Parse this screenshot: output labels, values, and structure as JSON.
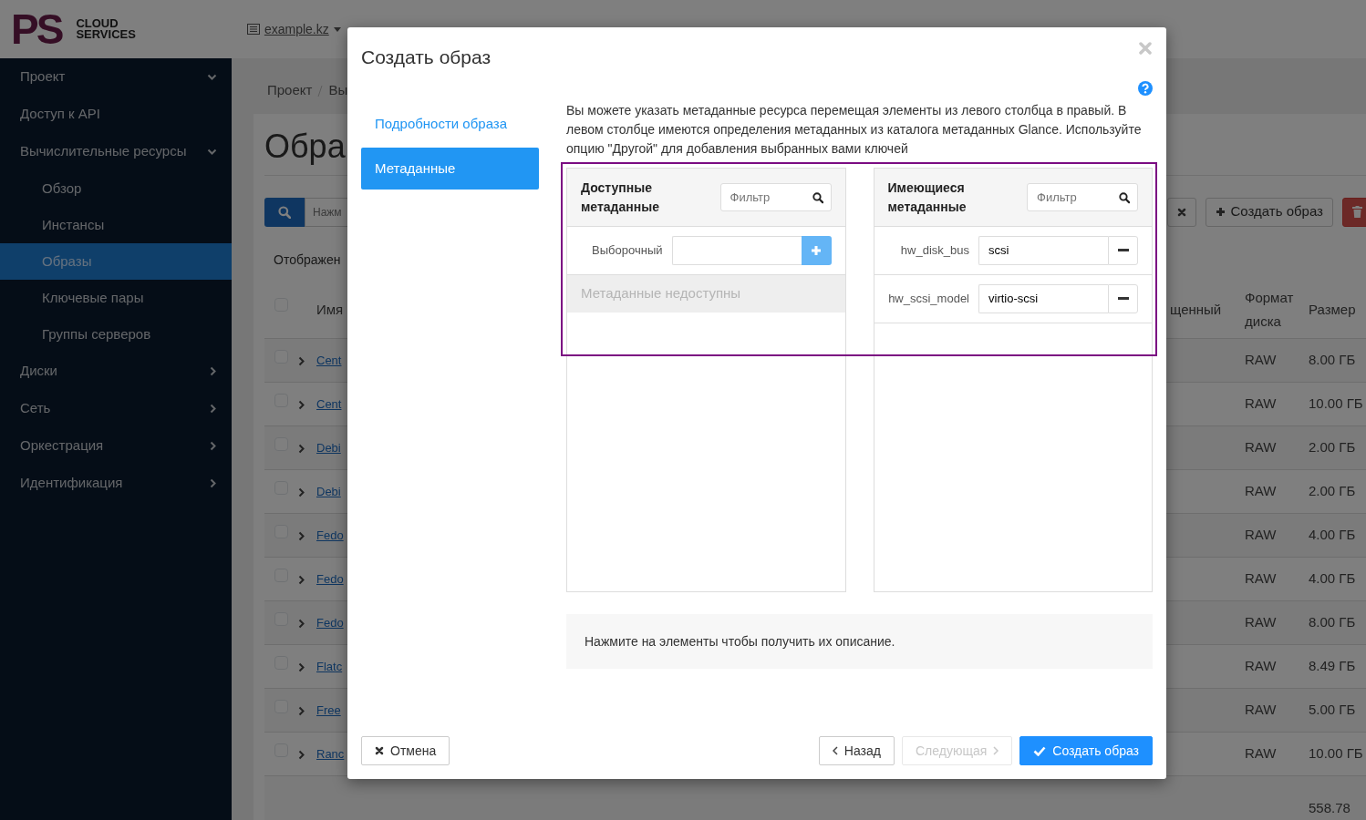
{
  "header": {
    "logo": {
      "mark": "PS",
      "lines": [
        "CLOUD",
        "SERVICES"
      ]
    },
    "project_selector": "example.kz"
  },
  "sidebar": {
    "items": [
      {
        "label": "Проект",
        "expanded": true,
        "selected": false,
        "children": [
          {
            "label": "Доступ к API",
            "selected": false
          },
          {
            "label": "Вычислительные ресурсы",
            "expanded": true,
            "selected": false,
            "children": [
              {
                "label": "Обзор",
                "selected": false
              },
              {
                "label": "Инстансы",
                "selected": false
              },
              {
                "label": "Образы",
                "selected": true
              },
              {
                "label": "Ключевые пары",
                "selected": false
              },
              {
                "label": "Группы серверов",
                "selected": false
              }
            ]
          },
          {
            "label": "Диски",
            "expanded": false,
            "selected": false
          },
          {
            "label": "Сеть",
            "expanded": false,
            "selected": false
          },
          {
            "label": "Оркестрация",
            "expanded": false,
            "selected": false
          }
        ]
      },
      {
        "label": "Идентификация",
        "expanded": false,
        "selected": false
      }
    ]
  },
  "page": {
    "breadcrumb": [
      "Проект",
      "Вы"
    ],
    "title": "Обра",
    "search": {
      "placeholder": "Нажм"
    },
    "actions": [
      {
        "kind": "clear"
      },
      {
        "kind": "create",
        "label": "Создать образ"
      },
      {
        "kind": "delete"
      }
    ],
    "summary": "Отображен",
    "table": {
      "select_all_checked": false,
      "columns": [
        "Имя",
        "щенный",
        "Формат диска",
        "Размер"
      ],
      "rows": [
        {
          "checked": false,
          "name": "Cent",
          "format": "RAW",
          "size": "8.00 ГБ"
        },
        {
          "checked": false,
          "name": "Cent",
          "format": "RAW",
          "size": "10.00 ГБ"
        },
        {
          "checked": false,
          "name": "Debi",
          "format": "RAW",
          "size": "2.00 ГБ"
        },
        {
          "checked": false,
          "name": "Debi",
          "format": "RAW",
          "size": "2.00 ГБ"
        },
        {
          "checked": false,
          "name": "Fedo",
          "format": "RAW",
          "size": "4.00 ГБ"
        },
        {
          "checked": false,
          "name": "Fedo",
          "format": "RAW",
          "size": "4.00 ГБ"
        },
        {
          "checked": false,
          "name": "Fedo",
          "format": "RAW",
          "size": "8.00 ГБ"
        },
        {
          "checked": false,
          "name": "Flatc",
          "format": "RAW",
          "size": "8.49 ГБ"
        },
        {
          "checked": false,
          "name": "Free",
          "format": "RAW",
          "size": "5.00 ГБ"
        },
        {
          "checked": false,
          "name": "Ranc",
          "format": "RAW",
          "size": "10.00 ГБ"
        }
      ],
      "total_size": "558.78"
    }
  },
  "modal": {
    "title": "Создать образ",
    "steps": [
      {
        "label": "Подробности образа",
        "selected": false
      },
      {
        "label": "Метаданные",
        "selected": true
      }
    ],
    "description": "Вы можете указать метаданные ресурса перемещая элементы из левого столбца в правый. В левом столбце имеются определения метаданных из каталога метаданных Glance. Используйте опцию \"Другой\" для добавления выбранных вами ключей",
    "available": {
      "title": "Доступные метаданные",
      "filter_placeholder": "Фильтр",
      "custom_label": "Выборочный",
      "empty_message": "Метаданные недоступны"
    },
    "existing": {
      "title": "Имеющиеся метаданные",
      "filter_placeholder": "Фильтр",
      "items": [
        {
          "key": "hw_disk_bus",
          "value": "scsi"
        },
        {
          "key": "hw_scsi_model",
          "value": "virtio-scsi"
        }
      ]
    },
    "hint": "Нажмите на элементы чтобы получить их описание.",
    "cancel": "Отмена",
    "buttons": [
      {
        "kind": "back",
        "label": "Назад",
        "disabled": false
      },
      {
        "kind": "next",
        "label": "Следующая",
        "disabled": true
      },
      {
        "kind": "primary",
        "label": "Создать образ",
        "disabled": false
      }
    ]
  }
}
